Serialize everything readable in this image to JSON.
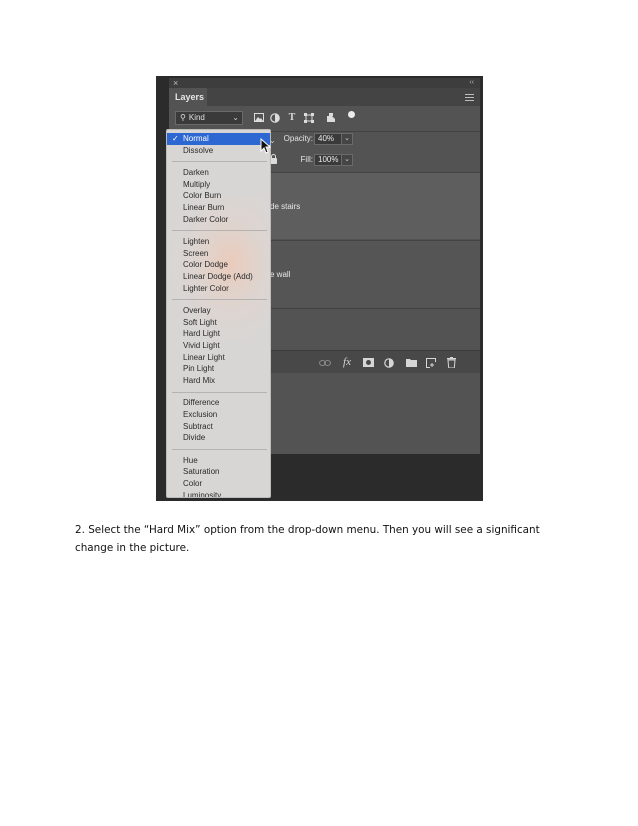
{
  "panel": {
    "close_glyph": "×",
    "collapse_glyph": "‹‹",
    "tab_label": "Layers"
  },
  "filter": {
    "kind_label": "Kind",
    "filter_icons": [
      "image-filter-icon",
      "adjustment-filter-icon",
      "type-filter-icon",
      "shape-filter-icon",
      "smart-object-filter-icon",
      "filter-toggle-icon"
    ]
  },
  "options": {
    "opacity_label": "Opacity:",
    "opacity_value": "40%",
    "fill_label": "Fill:",
    "fill_value": "100%"
  },
  "layers": [
    {
      "name_fragment": "de stairs"
    },
    {
      "name_fragment": "e wall"
    }
  ],
  "blend_menu": {
    "selected_index": 0,
    "check_glyph": "✓",
    "groups": [
      [
        "Normal",
        "Dissolve"
      ],
      [
        "Darken",
        "Multiply",
        "Color Burn",
        "Linear Burn",
        "Darker Color"
      ],
      [
        "Lighten",
        "Screen",
        "Color Dodge",
        "Linear Dodge (Add)",
        "Lighter Color"
      ],
      [
        "Overlay",
        "Soft Light",
        "Hard Light",
        "Vivid Light",
        "Linear Light",
        "Pin Light",
        "Hard Mix"
      ],
      [
        "Difference",
        "Exclusion",
        "Subtract",
        "Divide"
      ],
      [
        "Hue",
        "Saturation",
        "Color",
        "Luminosity"
      ]
    ]
  },
  "bottom_icons": [
    "link-layers-icon",
    "fx-icon",
    "mask-icon",
    "new-fill-adjustment-icon",
    "group-folder-icon",
    "new-layer-icon",
    "trash-icon"
  ],
  "colors": {
    "selection": "#2d67d2",
    "panel_bg": "#535353",
    "outer_bg": "#2b2b2b"
  },
  "caption": {
    "text": "2. Select the “Hard Mix” option from the drop-down menu. Then you will see a significant change in the picture."
  }
}
